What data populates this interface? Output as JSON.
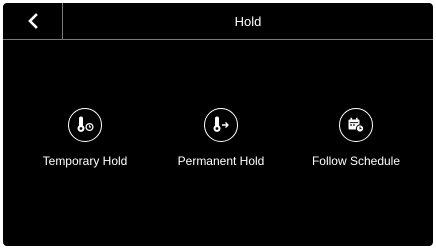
{
  "header": {
    "title": "Hold",
    "back_icon": "chevron-left-icon"
  },
  "options": [
    {
      "label": "Temporary Hold",
      "icon": "thermometer-clock-icon"
    },
    {
      "label": "Permanent Hold",
      "icon": "thermometer-arrow-icon"
    },
    {
      "label": "Follow Schedule",
      "icon": "calendar-clock-icon"
    }
  ],
  "colors": {
    "background": "#000000",
    "foreground": "#ffffff",
    "divider": "#7a7a7a"
  }
}
